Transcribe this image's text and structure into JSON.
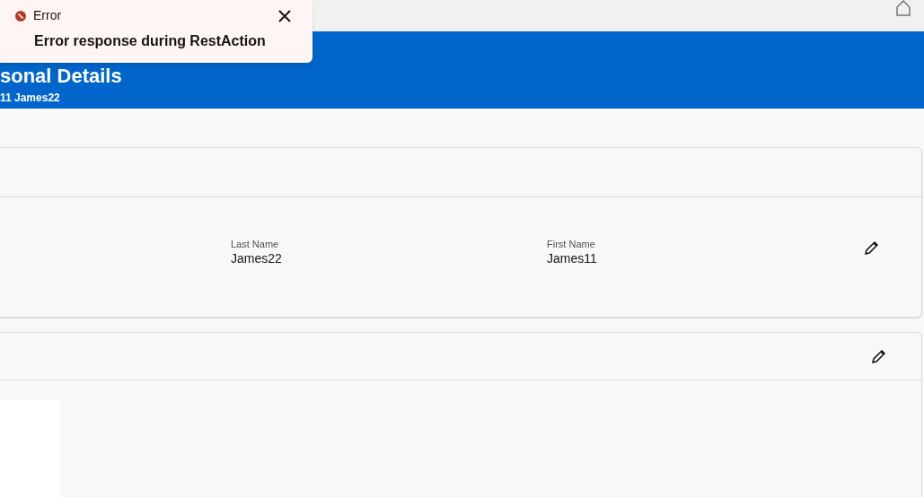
{
  "toast": {
    "title": "Error",
    "message": "Error response during RestAction"
  },
  "header": {
    "title": "sonal Details",
    "subtitle": "11 James22"
  },
  "name_card": {
    "fields": [
      {
        "label": "Last Name",
        "value": "James22"
      },
      {
        "label": "First Name",
        "value": "James11"
      }
    ]
  }
}
